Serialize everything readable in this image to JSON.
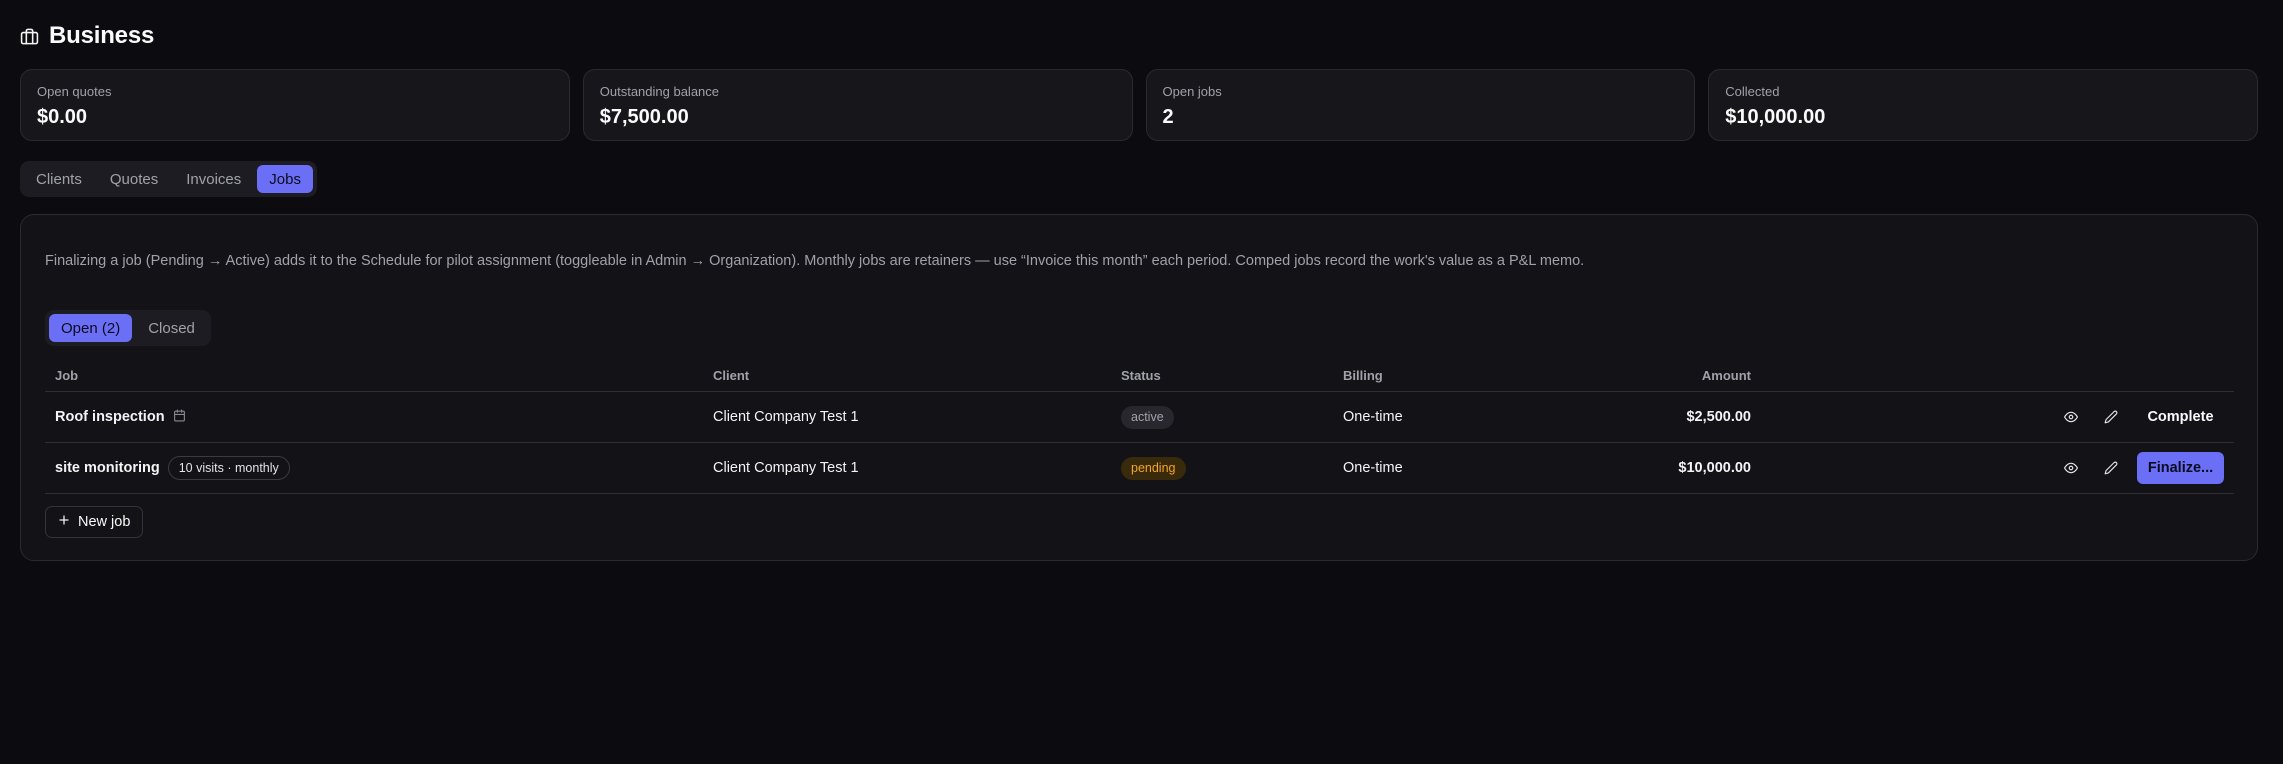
{
  "header": {
    "title": "Business",
    "icon": "briefcase-icon"
  },
  "stats": [
    {
      "label": "Open quotes",
      "value": "$0.00"
    },
    {
      "label": "Outstanding balance",
      "value": "$7,500.00"
    },
    {
      "label": "Open jobs",
      "value": "2"
    },
    {
      "label": "Collected",
      "value": "$10,000.00"
    }
  ],
  "tabs": [
    "Clients",
    "Quotes",
    "Invoices",
    "Jobs"
  ],
  "active_tab": "Jobs",
  "panel": {
    "info": "Finalizing a job (Pending → Active) adds it to the Schedule for pilot assignment (toggleable in Admin → Organization). Monthly jobs are retainers — use “Invoice this month” each period. Comped jobs record the work's value as a P&L memo.",
    "subtabs": [
      "Open (2)",
      "Closed"
    ],
    "active_subtab": "Open (2)",
    "columns": {
      "job": "Job",
      "client": "Client",
      "status": "Status",
      "billing": "Billing",
      "amount": "Amount"
    },
    "rows": [
      {
        "job": "Roof inspection",
        "job_icon": "calendar-icon",
        "tag": "",
        "client": "Client Company Test 1",
        "status": "active",
        "billing": "One-time",
        "amount": "$2,500.00",
        "action": "Complete"
      },
      {
        "job": "site monitoring",
        "tag": "10 visits · monthly",
        "client": "Client Company Test 1",
        "status": "pending",
        "billing": "One-time",
        "amount": "$10,000.00",
        "action": "Finalize..."
      }
    ],
    "new_job_label": "New job"
  },
  "colors": {
    "background": "#0c0c10",
    "accent": "#6b6ff5",
    "pending": "#f5a524"
  }
}
